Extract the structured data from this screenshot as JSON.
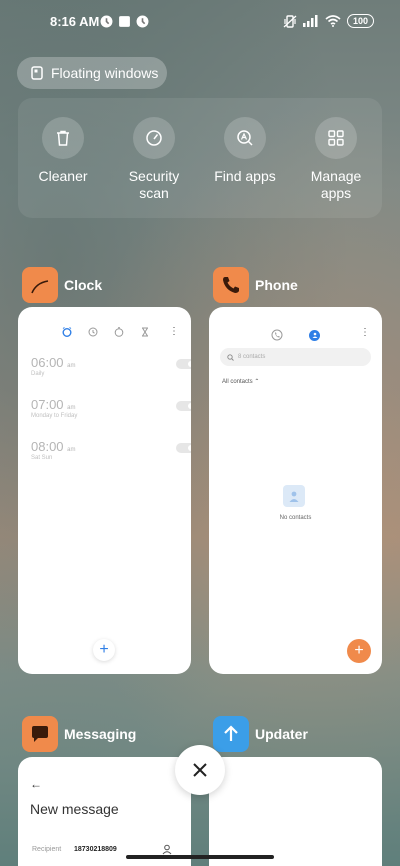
{
  "status": {
    "time": "8:16 AM",
    "battery": "100"
  },
  "floating": {
    "label": "Floating windows"
  },
  "tools": [
    {
      "label": "Cleaner"
    },
    {
      "label": "Security\nscan"
    },
    {
      "label": "Find apps"
    },
    {
      "label": "Manage\napps"
    }
  ],
  "apps": {
    "clock": {
      "name": "Clock",
      "alarms": [
        {
          "time": "06:00",
          "ampm": "am",
          "sub": "Daily"
        },
        {
          "time": "07:00",
          "ampm": "am",
          "sub": "Monday to Friday"
        },
        {
          "time": "08:00",
          "ampm": "am",
          "sub": "Sat Sun"
        }
      ]
    },
    "phone": {
      "name": "Phone",
      "search_placeholder": "8 contacts",
      "filter": "All contacts",
      "empty": "No contacts"
    },
    "messaging": {
      "name": "Messaging",
      "title": "New message",
      "recipient_label": "Recipient",
      "recipient_value": "18730218809"
    },
    "updater": {
      "name": "Updater"
    }
  },
  "colors": {
    "accent_orange": "#f08a4b",
    "updater_blue": "#3b9ee8",
    "clock_blue": "#2f7fe6"
  }
}
